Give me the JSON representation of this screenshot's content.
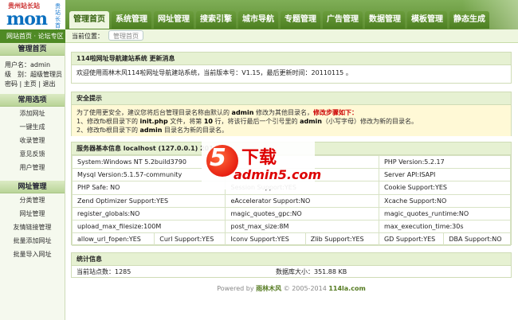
{
  "logo": {
    "site_name": "贵州站长站",
    "brand": "mon",
    "side_text": "贵站长首站"
  },
  "top_tabs": [
    "管理首页",
    "系统管理",
    "网址管理",
    "搜索引擎",
    "城市导航",
    "专题管理",
    "广告管理",
    "数据管理",
    "模板管理",
    "静态生成"
  ],
  "sub_left": "网站首页 · 论坛专区",
  "location": {
    "label": "当前位置：",
    "crumb": "管理首页"
  },
  "sidebar": {
    "home_title": "管理首页",
    "user_line": "用户名：admin",
    "level_line": "级　别：超级管理员",
    "links_line": "密码 | 主页 | 退出",
    "common_title": "常用选项",
    "common_items": [
      "添加网址",
      "一键生成",
      "收录管理",
      "意见反馈",
      "用户管理"
    ],
    "url_title": "网址管理",
    "url_items": [
      "分类管理",
      "网址管理",
      "友情链接管理",
      "批量添加网址",
      "批量导入网址"
    ]
  },
  "welcome": {
    "title": "114啦网址导航建站系统 更新消息",
    "text": "欢迎使用雨林木风114啦网址导航建站系统，当前版本号：V1.15，最后更新时间：20110115 。"
  },
  "security": {
    "title": "安全提示",
    "line1_a": "为了使用更安全，建议您将后台管理目录名称由默认的 ",
    "line1_b": "admin",
    "line1_c": " 修改为其他目录名，",
    "line1_d": "修改步骤如下：",
    "line2_a": "1、修改fb根目录下的 ",
    "line2_b": "init.php",
    "line2_c": " 文件，将第 ",
    "line2_d": "10",
    "line2_e": " 行，将该行最后一个引号里的 ",
    "line2_f": "admin",
    "line2_g": "（小写字母）修改为新的目录名。",
    "line3_a": "2、修改fb根目录下的 ",
    "line3_b": "admin",
    "line3_c": " 目录名为新的目录名。"
  },
  "server": {
    "title": "服务器基本信息 localhost (127.0.0.1)  2014年",
    "rows": [
      [
        "System:Windows NT 5.2build3790",
        "",
        "PHP Version:5.2.17"
      ],
      [
        "Mysql Version:5.1.57-community",
        "",
        "Server API:ISAPI"
      ],
      [
        "PHP Safe: NO",
        "Session Support:YES",
        "Cookie Support:YES"
      ],
      [
        "Zend Optimizer Support:YES",
        "eAccelerator Support:NO",
        "Xcache Support:NO"
      ],
      [
        "register_globals:NO",
        "magic_quotes_gpc:NO",
        "magic_quotes_runtime:NO"
      ],
      [
        "upload_max_filesize:100M",
        "post_max_size:8M",
        "max_execution_time:30s"
      ]
    ],
    "last_row": [
      "allow_url_fopen:YES",
      "Curl Support:YES",
      "Iconv Support:YES",
      "Zlib Support:YES",
      "GD Support:YES",
      "DBA Support:NO"
    ]
  },
  "stats": {
    "title": "统计信息",
    "sites": "当前站点数：1285",
    "db_size": "数据库大小：351.88 KB"
  },
  "footer": {
    "powered": "Powered by ",
    "brand": "雨林木风",
    "copy": " © 2005-2014 ",
    "site": "114la.com"
  },
  "watermark": {
    "five": "5",
    "download": "下载",
    "site": "admin5.com"
  }
}
